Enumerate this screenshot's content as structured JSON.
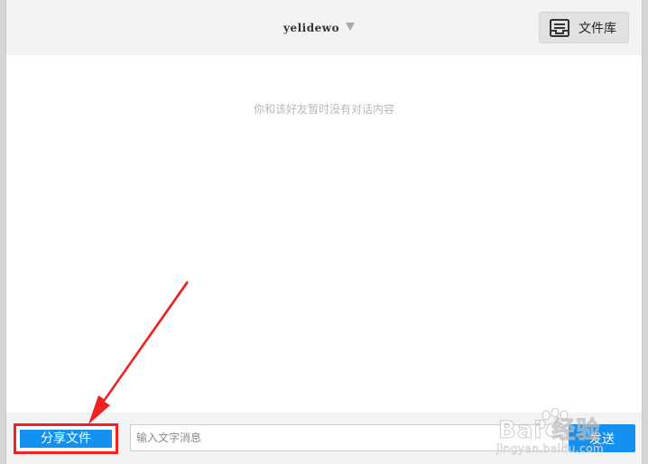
{
  "header": {
    "contact_name": "yelidewo",
    "library_label": "文件库"
  },
  "messages": {
    "empty_hint": "你和该好友暂时没有对话内容"
  },
  "footer": {
    "share_label": "分享文件",
    "input_placeholder": "输入文字消息",
    "input_value": "",
    "send_label": "发送"
  },
  "watermark": {
    "brand": "Bai 经验",
    "url": "jingyan.baidu.com"
  },
  "colors": {
    "accent": "#1390f0",
    "annotation": "#ee2222",
    "header_bg": "#f3f3f3"
  },
  "icons": {
    "dropdown": "dropdown-triangle-icon",
    "library": "inbox-tray-icon",
    "annotation": "red-arrow-icon",
    "watermark": "paw-print-icon"
  }
}
